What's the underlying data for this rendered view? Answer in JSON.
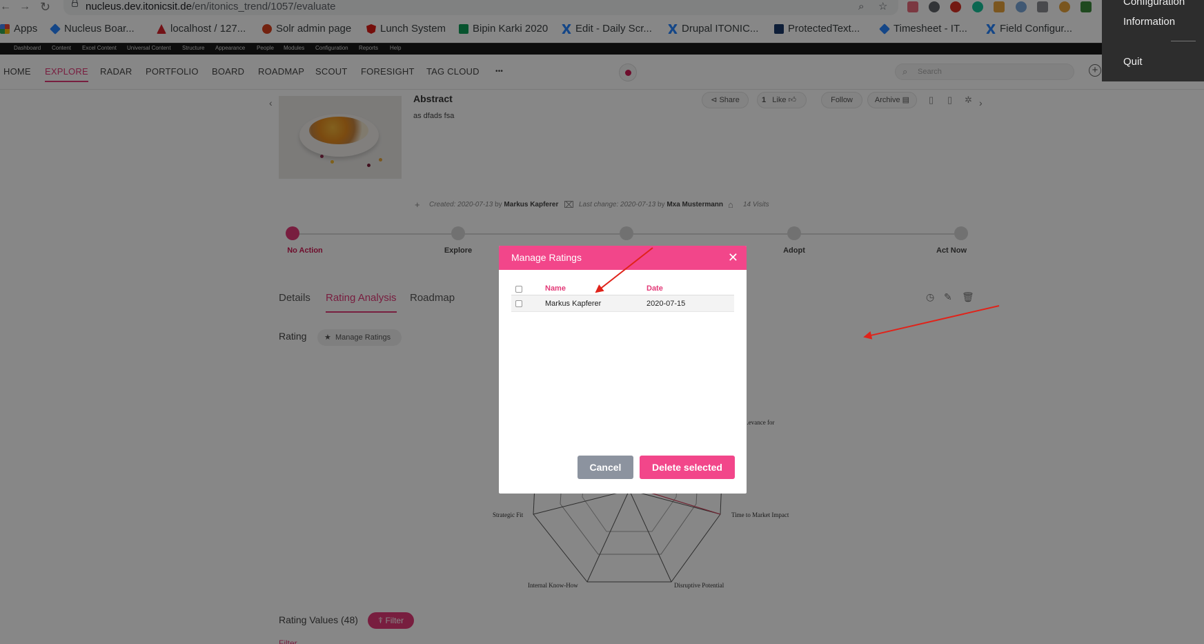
{
  "browser": {
    "url_host": "nucleus.dev.itonicsit.de",
    "url_path": "/en/itonics_trend/1057/evaluate"
  },
  "bookmarks": [
    {
      "label": "Apps",
      "color": "#4285f4"
    },
    {
      "label": "Nucleus Boar...",
      "color": "#2684ff"
    },
    {
      "label": "localhost / 127...",
      "color": "#d9232d"
    },
    {
      "label": "Solr admin page",
      "color": "#d9411e"
    },
    {
      "label": "Lunch System",
      "color": "#dd1b16"
    },
    {
      "label": "Bipin Karki 2020",
      "color": "#0f9d58"
    },
    {
      "label": "Edit - Daily Scr...",
      "color": "#2684ff"
    },
    {
      "label": "Drupal ITONIC...",
      "color": "#2684ff"
    },
    {
      "label": "ProtectedText...",
      "color": "#1b3a6b"
    },
    {
      "label": "Timesheet - IT...",
      "color": "#2684ff"
    },
    {
      "label": "Field Configur...",
      "color": "#2684ff"
    }
  ],
  "admin_toolbar": [
    "Dashboard",
    "Content",
    "Excel Content",
    "Universal Content",
    "Structure",
    "Appearance",
    "People",
    "Modules",
    "Configuration",
    "Reports",
    "Help"
  ],
  "user_menu": {
    "item1": "Configuration",
    "item2": "Information",
    "item3": "Quit"
  },
  "main_nav": {
    "items": [
      "HOME",
      "EXPLORE",
      "RADAR",
      "PORTFOLIO",
      "BOARD",
      "ROADMAP",
      "SCOUT",
      "FORESIGHT",
      "TAG CLOUD"
    ],
    "more": "•••",
    "active": "EXPLORE",
    "search_placeholder": "Search"
  },
  "entity": {
    "abstract_title": "Abstract",
    "abstract_text": "as dfads fsa",
    "share": "Share",
    "like_count": "1",
    "like": "Like",
    "follow": "Follow",
    "archive": "Archive",
    "created_label": "Created:",
    "created_date": "2020-07-13",
    "created_by_word": "by",
    "created_by": "Markus Kapferer",
    "changed_label": "Last change:",
    "changed_date": "2020-07-13",
    "changed_by": "Mxa Mustermann",
    "visits": "14 Visits"
  },
  "stages": [
    {
      "label": "No Action",
      "active": true
    },
    {
      "label": "Explore",
      "active": false
    },
    {
      "label": "",
      "active": false
    },
    {
      "label": "Adopt",
      "active": false
    },
    {
      "label": "Act Now",
      "active": false
    }
  ],
  "tabs": {
    "details": "Details",
    "rating_analysis": "Rating Analysis",
    "roadmap": "Roadmap"
  },
  "rating": {
    "heading": "Rating",
    "manage_button": "Manage Ratings",
    "values_heading": "Rating Values (48)",
    "filter_button": "Filter",
    "filter_link": "Filter"
  },
  "chart_data": {
    "type": "radar",
    "title": "",
    "visible_axis_labels": [
      "...evance for",
      "Time to Market Impact",
      "Disruptive Potential",
      "Internal Know-How",
      "Strategic Fit"
    ]
  },
  "modal": {
    "title": "Manage Ratings",
    "columns": {
      "name": "Name",
      "date": "Date"
    },
    "rows": [
      {
        "name": "Markus Kapferer",
        "date": "2020-07-15"
      }
    ],
    "cancel": "Cancel",
    "delete": "Delete selected"
  },
  "colors": {
    "accent": "#e33a78",
    "modal_header": "#f2468a",
    "cancel_grey": "#8c939f",
    "annotation_arrow": "#e0231a"
  }
}
